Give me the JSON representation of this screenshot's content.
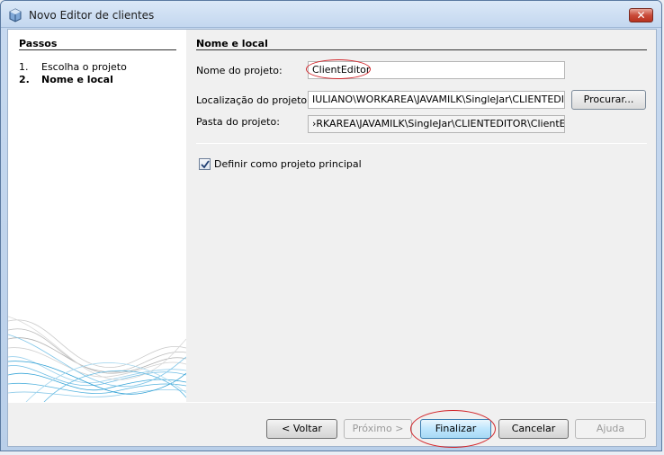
{
  "window": {
    "title": "Novo Editor de clientes",
    "close_symbol": "✕"
  },
  "steps": {
    "title": "Passos",
    "items": [
      {
        "num": "1.",
        "label": "Escolha o projeto"
      },
      {
        "num": "2.",
        "label": "Nome e local"
      }
    ]
  },
  "form": {
    "title": "Nome e local",
    "project_name_label": "Nome do projeto:",
    "project_name_value": "ClientEditor",
    "location_label": "Localização do projeto:",
    "location_value": "IULIANO\\WORKAREA\\JAVAMILK\\SingleJar\\CLIENTEDITOR",
    "browse_label": "Procurar...",
    "folder_label": "Pasta do projeto:",
    "folder_value": "›RKAREA\\JAVAMILK\\SingleJar\\CLIENTEDITOR\\ClientEditor",
    "main_project_label": "Definir como projeto principal",
    "main_project_checked": true
  },
  "buttons": {
    "back": "< Voltar",
    "next": "Próximo >",
    "finish": "Finalizar",
    "cancel": "Cancelar",
    "help": "Ajuda"
  },
  "colors": {
    "highlight_ellipse": "#d2252a",
    "title_bar": "#c3d7ef",
    "wave_blue": "#3aa6d8"
  }
}
